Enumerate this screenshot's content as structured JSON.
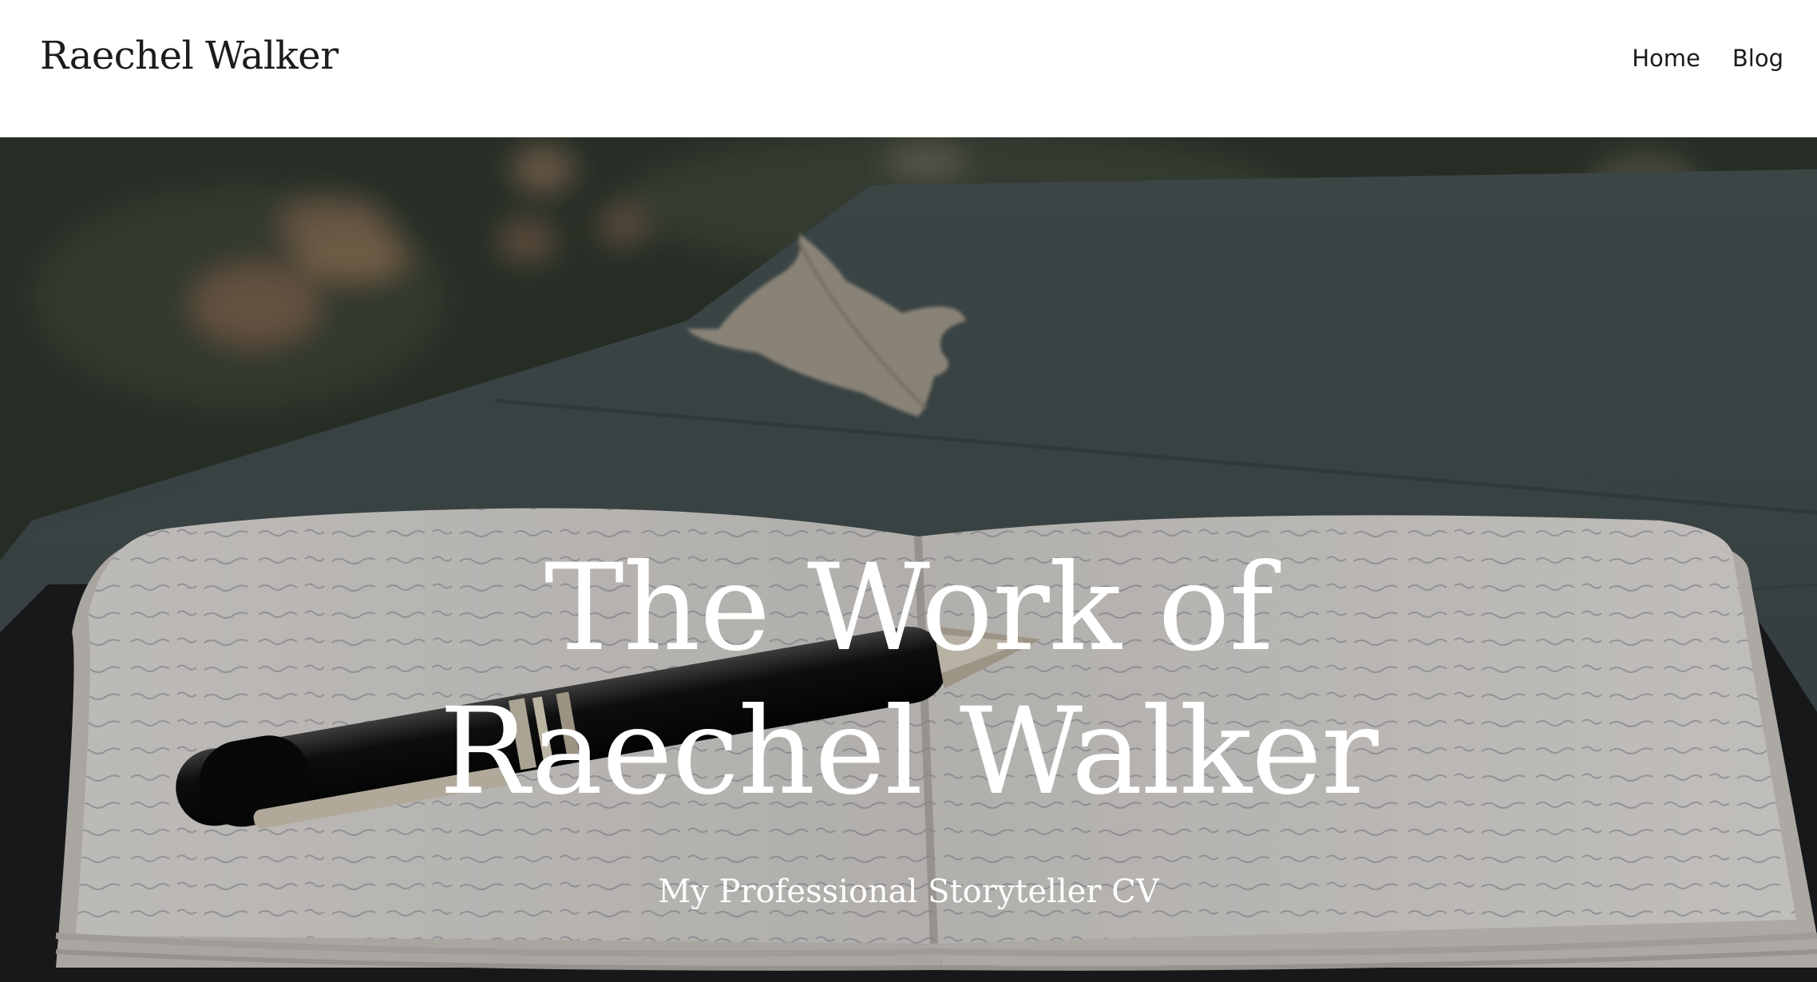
{
  "header": {
    "site_title": "Raechel Walker",
    "nav": [
      {
        "label": "Home"
      },
      {
        "label": "Blog"
      }
    ]
  },
  "hero": {
    "heading_line1": "The Work of",
    "heading_line2": "Raechel Walker",
    "subtitle": "My Professional Storyteller CV",
    "background": "photo of an open handwritten notebook with a black and gold pen on a grey wooden table, a dry leaf behind, darkened overlay"
  },
  "colors": {
    "header_bg": "#ffffff",
    "text_dark": "#1c1c1c",
    "hero_text": "#ffffff"
  }
}
